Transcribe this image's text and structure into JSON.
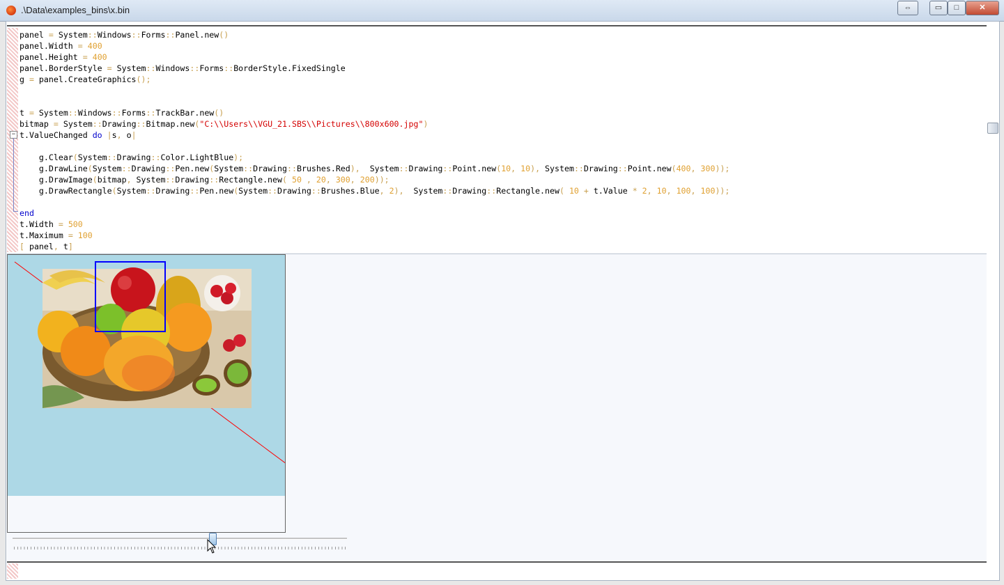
{
  "window": {
    "title": ".\\Data\\examples_bins\\x.bin",
    "buttons": {
      "restore_glyph": "⇔",
      "minimize_glyph": "▭",
      "maximize_glyph": "□",
      "close_glyph": "✕"
    }
  },
  "code_lines": [
    "panel = System::Windows::Forms::Panel.new()",
    "panel.Width = 400",
    "panel.Height = 400",
    "panel.BorderStyle = System::Windows::Forms::BorderStyle.FixedSingle",
    "g = panel.CreateGraphics();",
    "",
    "",
    "t = System::Windows::Forms::TrackBar.new()",
    "bitmap = System::Drawing::Bitmap.new(\"C:\\\\Users\\\\VGU_21.SBS\\\\Pictures\\\\800x600.jpg\")",
    "t.ValueChanged do |s, o|",
    "",
    "    g.Clear(System::Drawing::Color.LightBlue);",
    "    g.DrawLine(System::Drawing::Pen.new(System::Drawing::Brushes.Red),  System::Drawing::Point.new(10, 10), System::Drawing::Point.new(400, 300));",
    "    g.DrawImage(bitmap, System::Drawing::Rectangle.new( 50 , 20, 300, 200));",
    "    g.DrawRectangle(System::Drawing::Pen.new(System::Drawing::Brushes.Blue, 2),  System::Drawing::Rectangle.new( 10 + t.Value * 2, 10, 100, 100));",
    "",
    "end",
    "t.Width = 500",
    "t.Maximum = 100",
    "[ panel, t]"
  ],
  "fold_glyph": "−",
  "trackbar": {
    "value": 60,
    "maximum": 100
  },
  "colors": {
    "panel_clear": "#add8e6",
    "line": "#ff0000",
    "rect": "#0000ff"
  },
  "icons": {
    "app": "app-flame-icon",
    "cursor": "mouse-pointer-icon"
  }
}
